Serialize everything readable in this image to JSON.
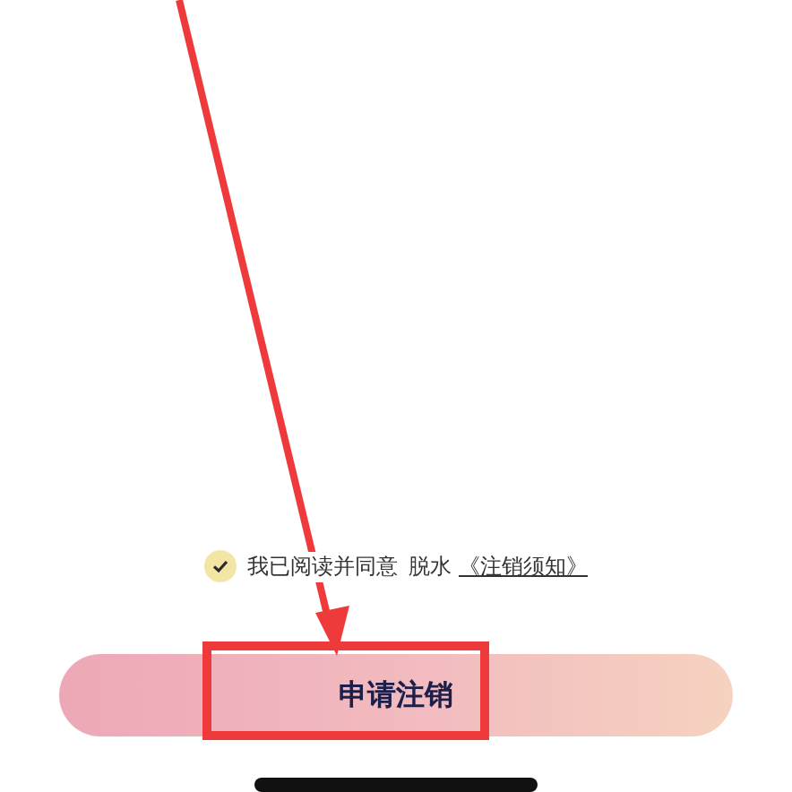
{
  "agreement": {
    "checked": true,
    "text": "我已阅读并同意",
    "app_name": "脱水",
    "link": "《注销须知》"
  },
  "submit_button": {
    "label": "申请注销"
  }
}
